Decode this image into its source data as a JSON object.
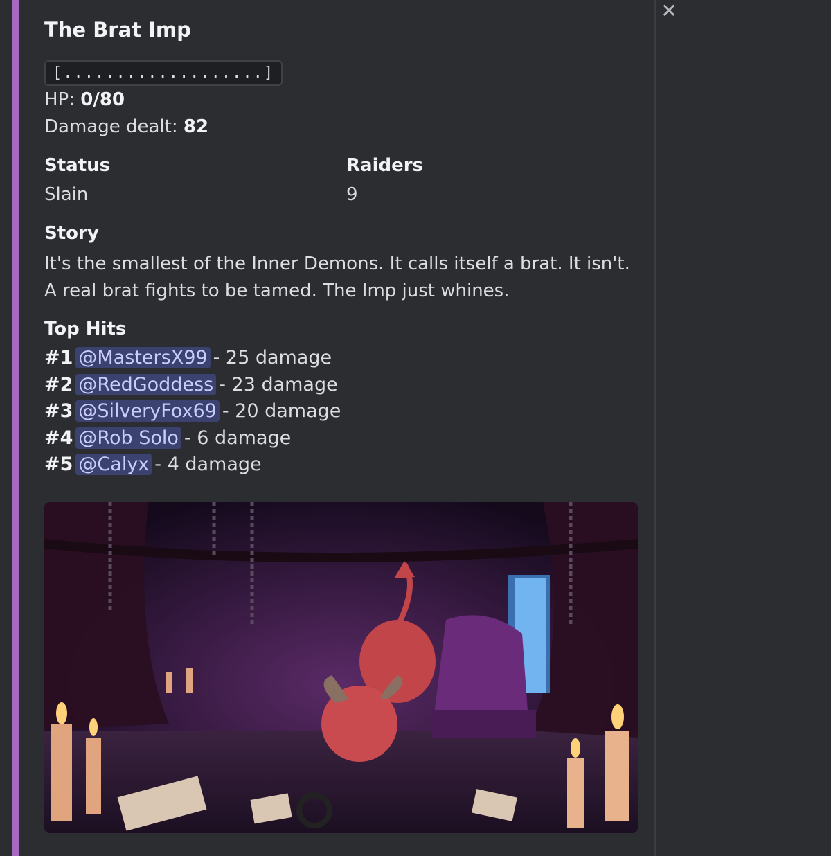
{
  "embed": {
    "accent_color": "#a56bc4",
    "title": "The Brat Imp",
    "hp_bar": "[...................]",
    "hp_label": "HP:",
    "hp_value": "0/80",
    "damage_label": "Damage dealt:",
    "damage_value": "82",
    "fields": [
      {
        "name": "Status",
        "value": "Slain"
      },
      {
        "name": "Raiders",
        "value": "9"
      }
    ],
    "story_name": "Story",
    "story_text": "It's the smallest of the Inner Demons. It calls itself a brat. It isn't. A real brat fights to be tamed. The Imp just whines.",
    "top_hits_name": "Top Hits",
    "top_hits": [
      {
        "rank": "#1",
        "user": "@MastersX99",
        "damage": "- 25 damage"
      },
      {
        "rank": "#2",
        "user": "@RedGoddess",
        "damage": "- 23 damage"
      },
      {
        "rank": "#3",
        "user": "@SilveryFox69",
        "damage": "- 20 damage"
      },
      {
        "rank": "#4",
        "user": "@Rob Solo",
        "damage": "- 6 damage"
      },
      {
        "rank": "#5",
        "user": "@Calyx",
        "damage": "- 4 damage"
      }
    ],
    "image_icon": "imp-illustration"
  },
  "close_icon": "close-icon"
}
